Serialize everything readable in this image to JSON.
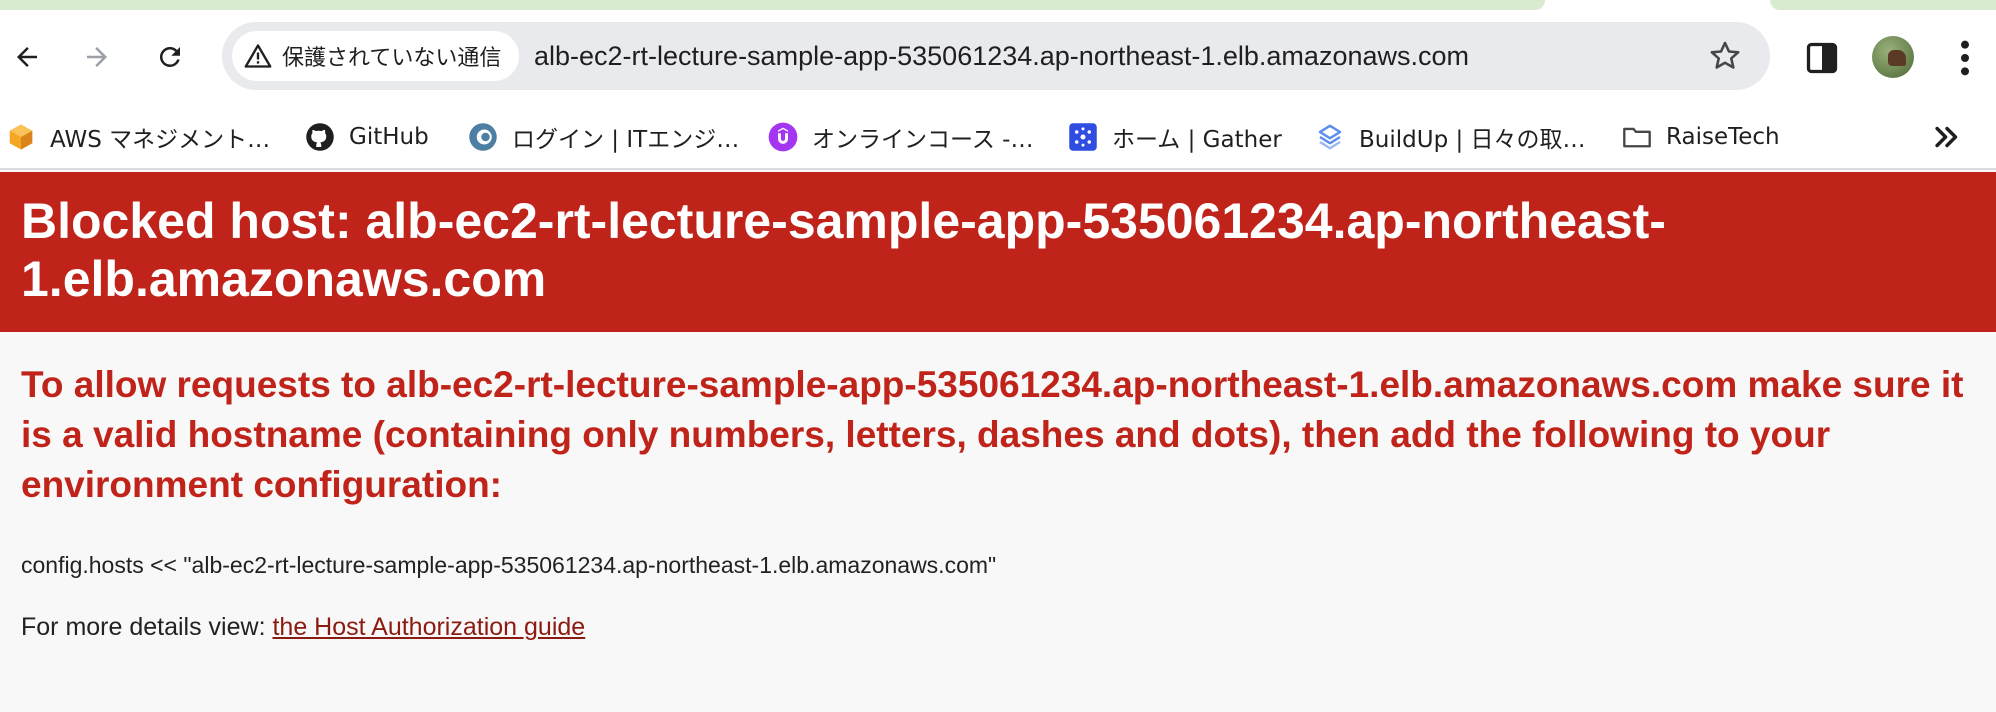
{
  "browser": {
    "security_label": "保護されていない通信",
    "url": "alb-ec2-rt-lecture-sample-app-535061234.ap-northeast-1.elb.amazonaws.com",
    "icons": [
      "back-arrow-icon",
      "forward-arrow-icon",
      "reload-icon",
      "warning-triangle-icon",
      "star-icon",
      "side-panel-icon",
      "profile-avatar",
      "kebab-menu-icon"
    ]
  },
  "bookmarks": [
    {
      "label": "AWS マネジメント…",
      "icon": "aws-cube-icon"
    },
    {
      "label": "GitHub",
      "icon": "github-icon"
    },
    {
      "label": "ログイン | ITエンジ…",
      "icon": "globe-icon"
    },
    {
      "label": "オンラインコース -…",
      "icon": "udemy-icon"
    },
    {
      "label": "ホーム | Gather",
      "icon": "gather-icon"
    },
    {
      "label": "BuildUp | 日々の取…",
      "icon": "buildup-icon"
    },
    {
      "label": "RaiseTech",
      "icon": "folder-icon"
    }
  ],
  "page": {
    "title": "Blocked host: alb-ec2-rt-lecture-sample-app-535061234.ap-northeast-1.elb.amazonaws.com",
    "message": "To allow requests to alb-ec2-rt-lecture-sample-app-535061234.ap-northeast-1.elb.amazonaws.com make sure it is a valid hostname (containing only numbers, letters, dashes and dots), then add the following to your environment configuration:",
    "config_line": "config.hosts << \"alb-ec2-rt-lecture-sample-app-535061234.ap-northeast-1.elb.amazonaws.com\"",
    "details_prefix": "For more details view: ",
    "details_link": "the Host Authorization guide"
  },
  "colors": {
    "banner": "#bf2319",
    "heading": "#bf2319",
    "link": "#8b1a10",
    "tab_accent": "#d9ebcf"
  }
}
